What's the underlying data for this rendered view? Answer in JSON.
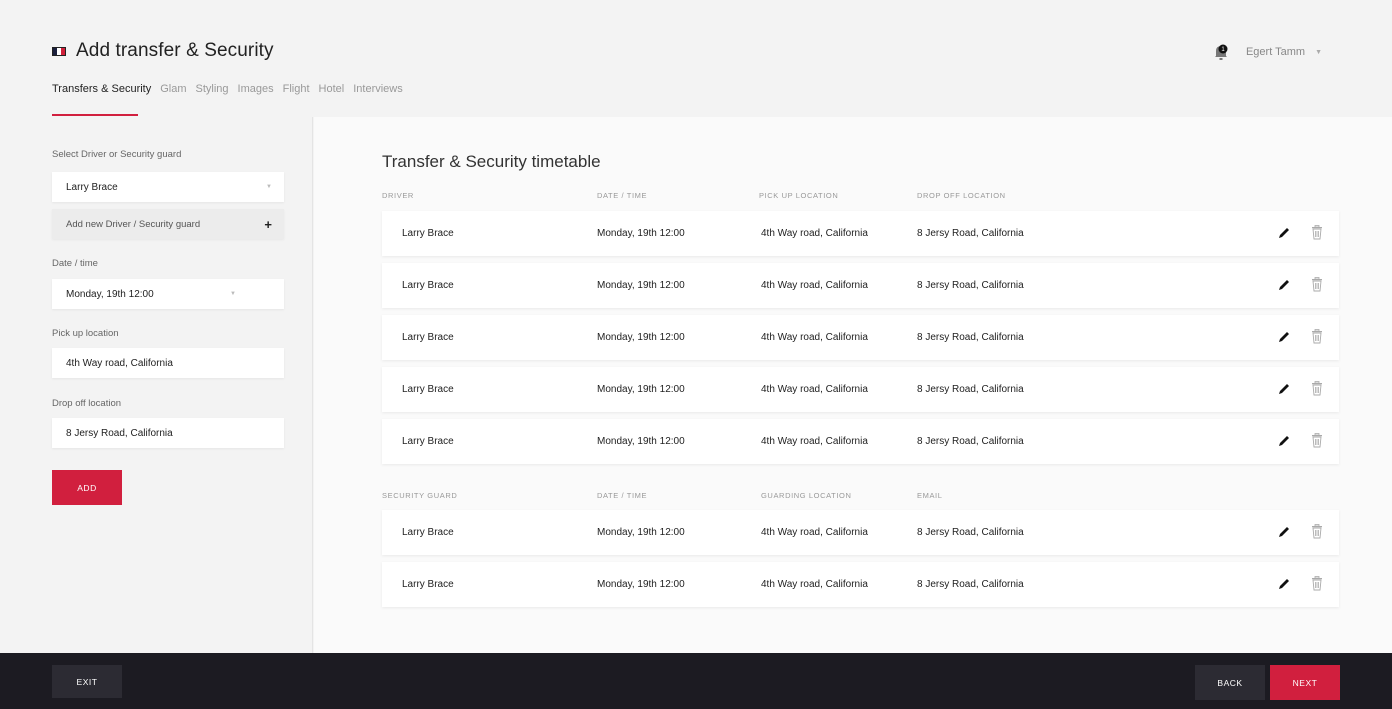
{
  "header": {
    "title": "Add transfer & Security",
    "user_name": "Egert Tamm",
    "notification_count": "1",
    "tabs": [
      {
        "label": "Transfers & Security"
      },
      {
        "label": "Glam"
      },
      {
        "label": "Styling"
      },
      {
        "label": "Images"
      },
      {
        "label": "Flight"
      },
      {
        "label": "Hotel"
      },
      {
        "label": "Interviews"
      }
    ]
  },
  "colors": {
    "accent": "#d11f3e",
    "footer": "#1c1b22"
  },
  "sidebar": {
    "select_label": "Select Driver or Security guard",
    "select_value": "Larry Brace",
    "add_new_label": "Add new Driver / Security guard",
    "date_label": "Date / time",
    "date_value": "Monday, 19th 12:00",
    "pickup_label": "Pick up location",
    "pickup_value": "4th Way road, California",
    "dropoff_label": "Drop off location",
    "dropoff_value": "8 Jersy Road, California",
    "add_button": "ADD"
  },
  "main": {
    "title": "Transfer & Security timetable",
    "driver_headers": [
      "DRIVER",
      "DATE / TIME",
      "PICK UP LOCATION",
      "DROP OFF LOCATION"
    ],
    "driver_rows": [
      [
        "Larry Brace",
        "Monday, 19th 12:00",
        "4th Way road, California",
        "8 Jersy Road, California"
      ],
      [
        "Larry Brace",
        "Monday, 19th 12:00",
        "4th Way road, California",
        "8 Jersy Road, California"
      ],
      [
        "Larry Brace",
        "Monday, 19th 12:00",
        "4th Way road, California",
        "8 Jersy Road, California"
      ],
      [
        "Larry Brace",
        "Monday, 19th 12:00",
        "4th Way road, California",
        "8 Jersy Road, California"
      ],
      [
        "Larry Brace",
        "Monday, 19th 12:00",
        "4th Way road, California",
        "8 Jersy Road, California"
      ]
    ],
    "security_headers": [
      "SECURITY GUARD",
      "DATE / TIME",
      "GUARDING LOCATION",
      "EMAIL"
    ],
    "security_rows": [
      [
        "Larry Brace",
        "Monday, 19th 12:00",
        "4th Way road, California",
        "8 Jersy Road, California"
      ],
      [
        "Larry Brace",
        "Monday, 19th 12:00",
        "4th Way road, California",
        "8 Jersy Road, California"
      ]
    ]
  },
  "footer": {
    "exit_label": "EXIT",
    "back_label": "BACK",
    "next_label": "NEXT"
  }
}
